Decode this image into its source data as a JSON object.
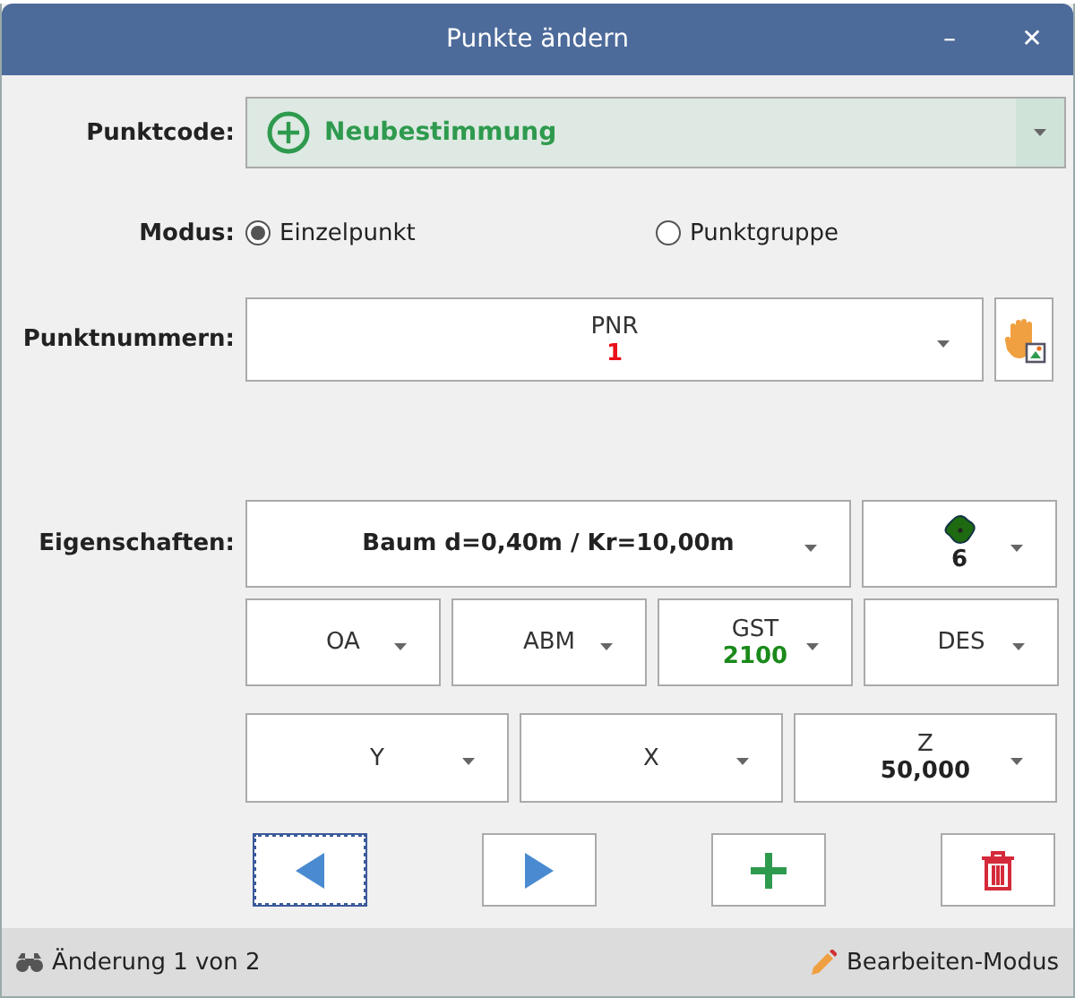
{
  "window": {
    "title": "Punkte ändern",
    "controls": [
      "–",
      "✕"
    ]
  },
  "punktcode": {
    "label": "Punktcode:",
    "value": "Neubestimmung"
  },
  "modus": {
    "label": "Modus:",
    "options": [
      {
        "label": "Einzelpunkt",
        "selected": true
      },
      {
        "label": "Punktgruppe",
        "selected": false
      }
    ]
  },
  "punktnummern": {
    "label": "Punktnummern:",
    "field": {
      "caption": "PNR",
      "value": "1",
      "color": "#e8101a"
    }
  },
  "eigenschaften": {
    "label": "Eigenschaften:",
    "description": "Baum d=0,40m / Kr=10,00m",
    "symbol_value": "6",
    "attributes": [
      {
        "caption": "OA"
      },
      {
        "caption": "ABM"
      },
      {
        "caption": "GST",
        "value": "2100",
        "color": "#1a8a1a"
      },
      {
        "caption": "DES"
      }
    ],
    "coordinates": [
      {
        "caption": "Y"
      },
      {
        "caption": "X"
      },
      {
        "caption": "Z",
        "value": "50,000",
        "color": "#222222"
      }
    ]
  },
  "buttons": [
    {
      "kind": "previous",
      "focused": true
    },
    {
      "kind": "next",
      "focused": false
    },
    {
      "kind": "add",
      "focused": false
    },
    {
      "kind": "delete",
      "focused": false
    }
  ],
  "status_bar": {
    "left": "Änderung 1 von 2",
    "right": "Bearbeiten-Modus"
  }
}
